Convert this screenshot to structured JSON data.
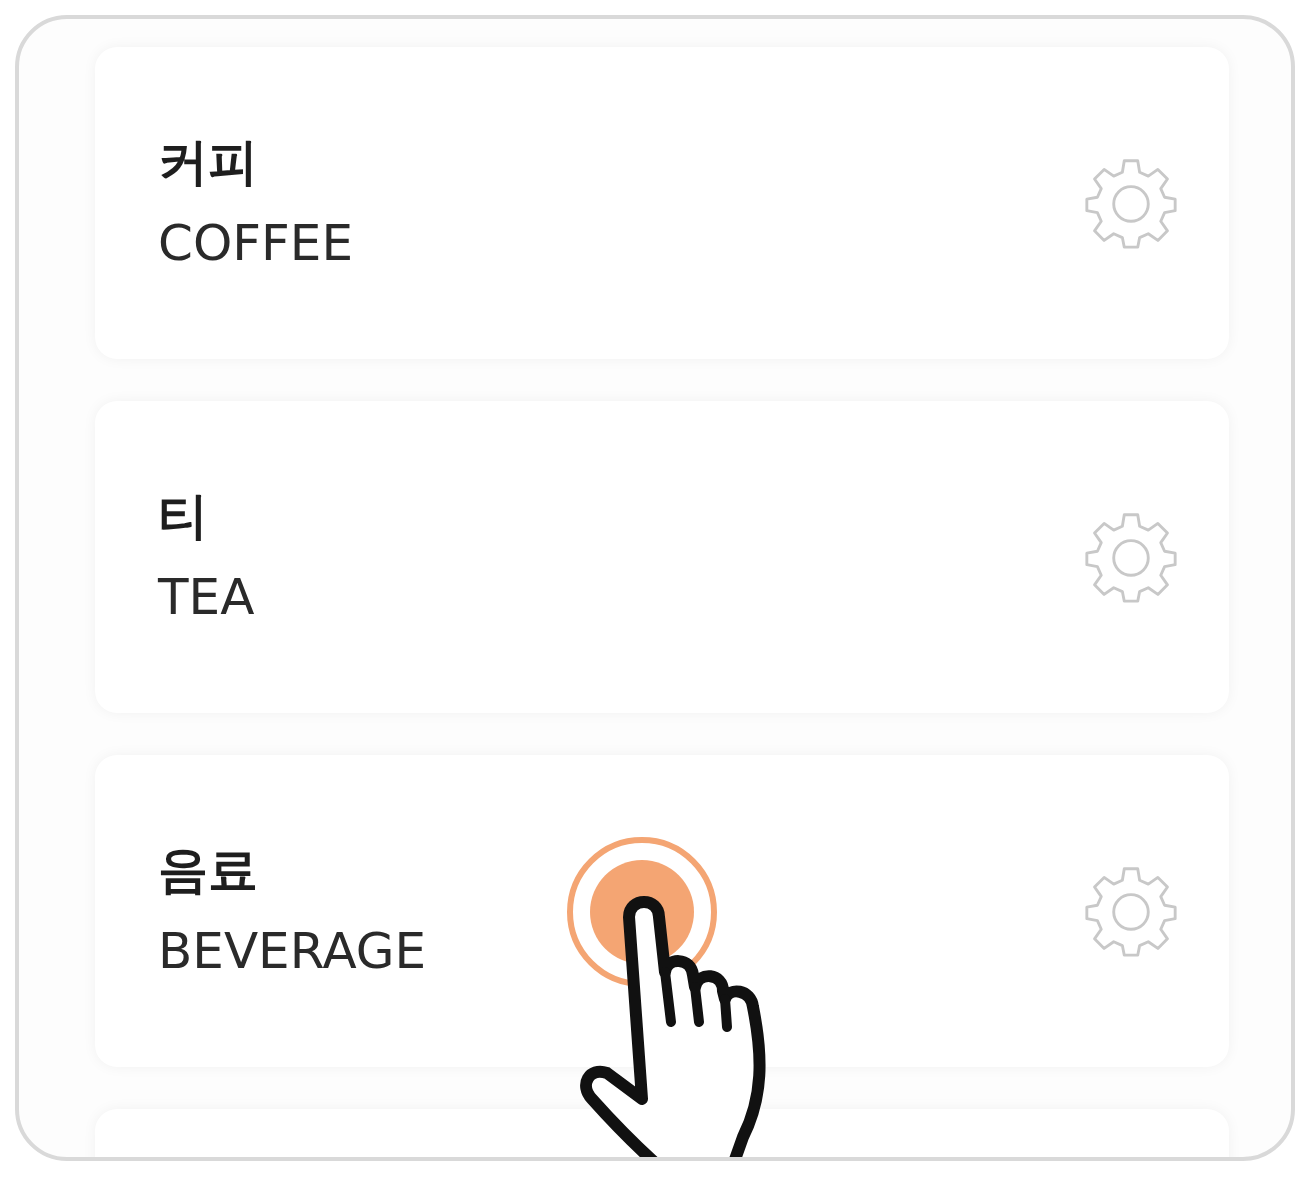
{
  "categories": [
    {
      "title": "커피",
      "subtitle": "COFFEE"
    },
    {
      "title": "티",
      "subtitle": "TEA"
    },
    {
      "title": "음료",
      "subtitle": "BEVERAGE"
    }
  ]
}
